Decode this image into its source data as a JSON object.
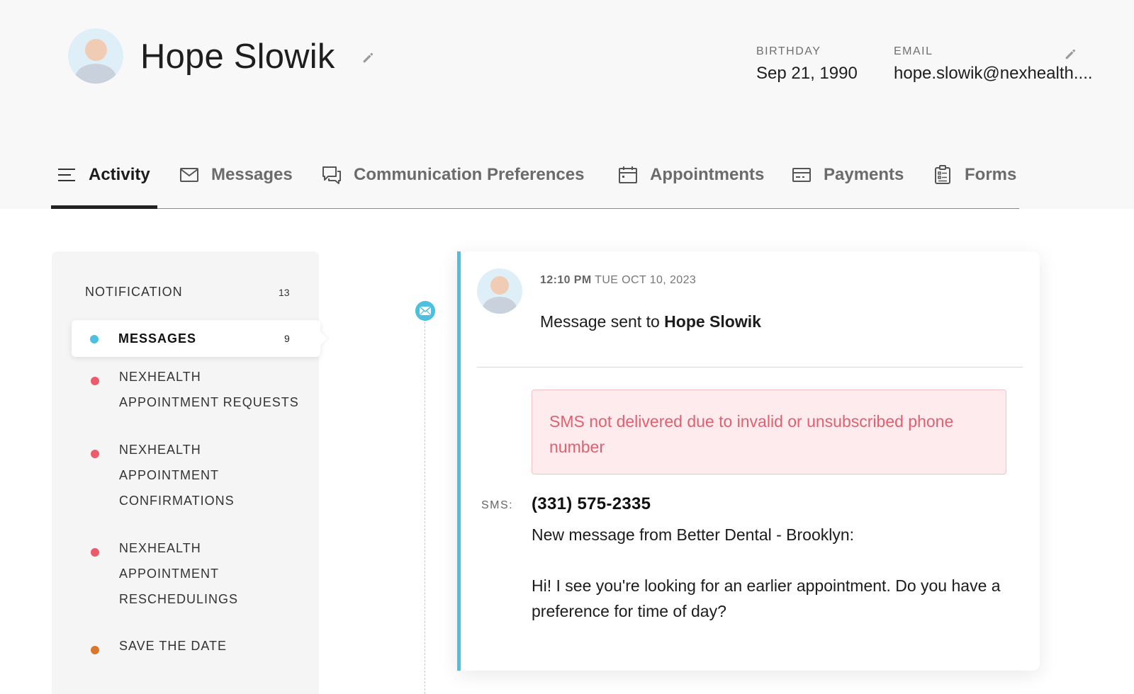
{
  "patient": {
    "name": "Hope Slowik",
    "birthday_label": "BIRTHDAY",
    "birthday": "Sep 21, 1990",
    "email_label": "EMAIL",
    "email": "hope.slowik@nexhealth...."
  },
  "tabs": [
    {
      "label": "Activity",
      "icon": "list-icon",
      "active": true
    },
    {
      "label": "Messages",
      "icon": "envelope-icon"
    },
    {
      "label": "Communication Preferences",
      "icon": "chat-bubbles-icon"
    },
    {
      "label": "Appointments",
      "icon": "calendar-icon"
    },
    {
      "label": "Payments",
      "icon": "card-icon"
    },
    {
      "label": "Forms",
      "icon": "clipboard-icon"
    }
  ],
  "sidebar": {
    "header": "NOTIFICATION",
    "header_count": "13",
    "items": [
      {
        "label": "MESSAGES",
        "count": "9",
        "color": "#4cc0de",
        "selected": true
      },
      {
        "label": "NEXHEALTH APPOINTMENT REQUESTS",
        "color": "#ec5b6c"
      },
      {
        "label": "NEXHEALTH APPOINTMENT CONFIRMATIONS",
        "color": "#ec5b6c"
      },
      {
        "label": "NEXHEALTH APPOINTMENT RESCHEDULINGS",
        "color": "#ec5b6c"
      },
      {
        "label": "SAVE THE DATE",
        "color": "#d9772f"
      }
    ]
  },
  "message": {
    "time": "12:10 PM",
    "date": "TUE OCT 10, 2023",
    "sent_prefix": "Message sent to",
    "recipient": "Hope Slowik",
    "error": "SMS not delivered due to invalid or unsubscribed phone number",
    "sms_label": "SMS:",
    "phone": "(331) 575-2335",
    "body": "New message from Better Dental - Brooklyn:\n\nHi! I see you're looking for an earlier appointment. Do you have a preference for time of day?"
  },
  "colors": {
    "accent": "#4cc0de",
    "error_text": "#e0606f",
    "error_bg": "#fdebed"
  }
}
